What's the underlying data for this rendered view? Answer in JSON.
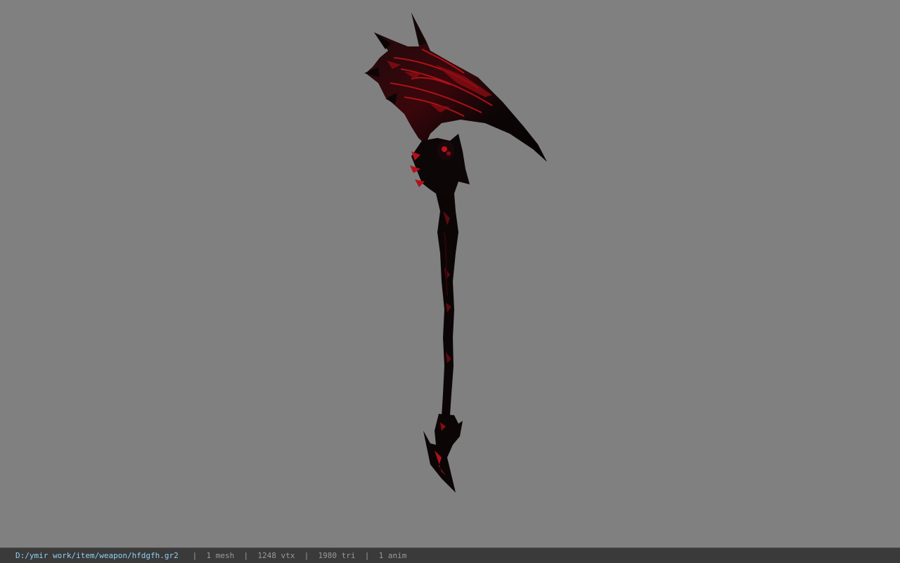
{
  "viewport": {
    "background": "#808080",
    "model_name": "scythe weapon model",
    "model_colors": {
      "dark": "#0b0607",
      "accent": "#c0141c",
      "mid": "#5a0a10"
    }
  },
  "status_bar": {
    "file_path": "D:/ymir work/item/weapon/hfdgfh.gr2",
    "separator": "|",
    "mesh_count": "1 mesh",
    "vertex_count": "1248 vtx",
    "triangle_count": "1980 tri",
    "anim_count": "1 anim",
    "path_color": "#8fd0f0",
    "text_color": "#9a9a9a"
  }
}
